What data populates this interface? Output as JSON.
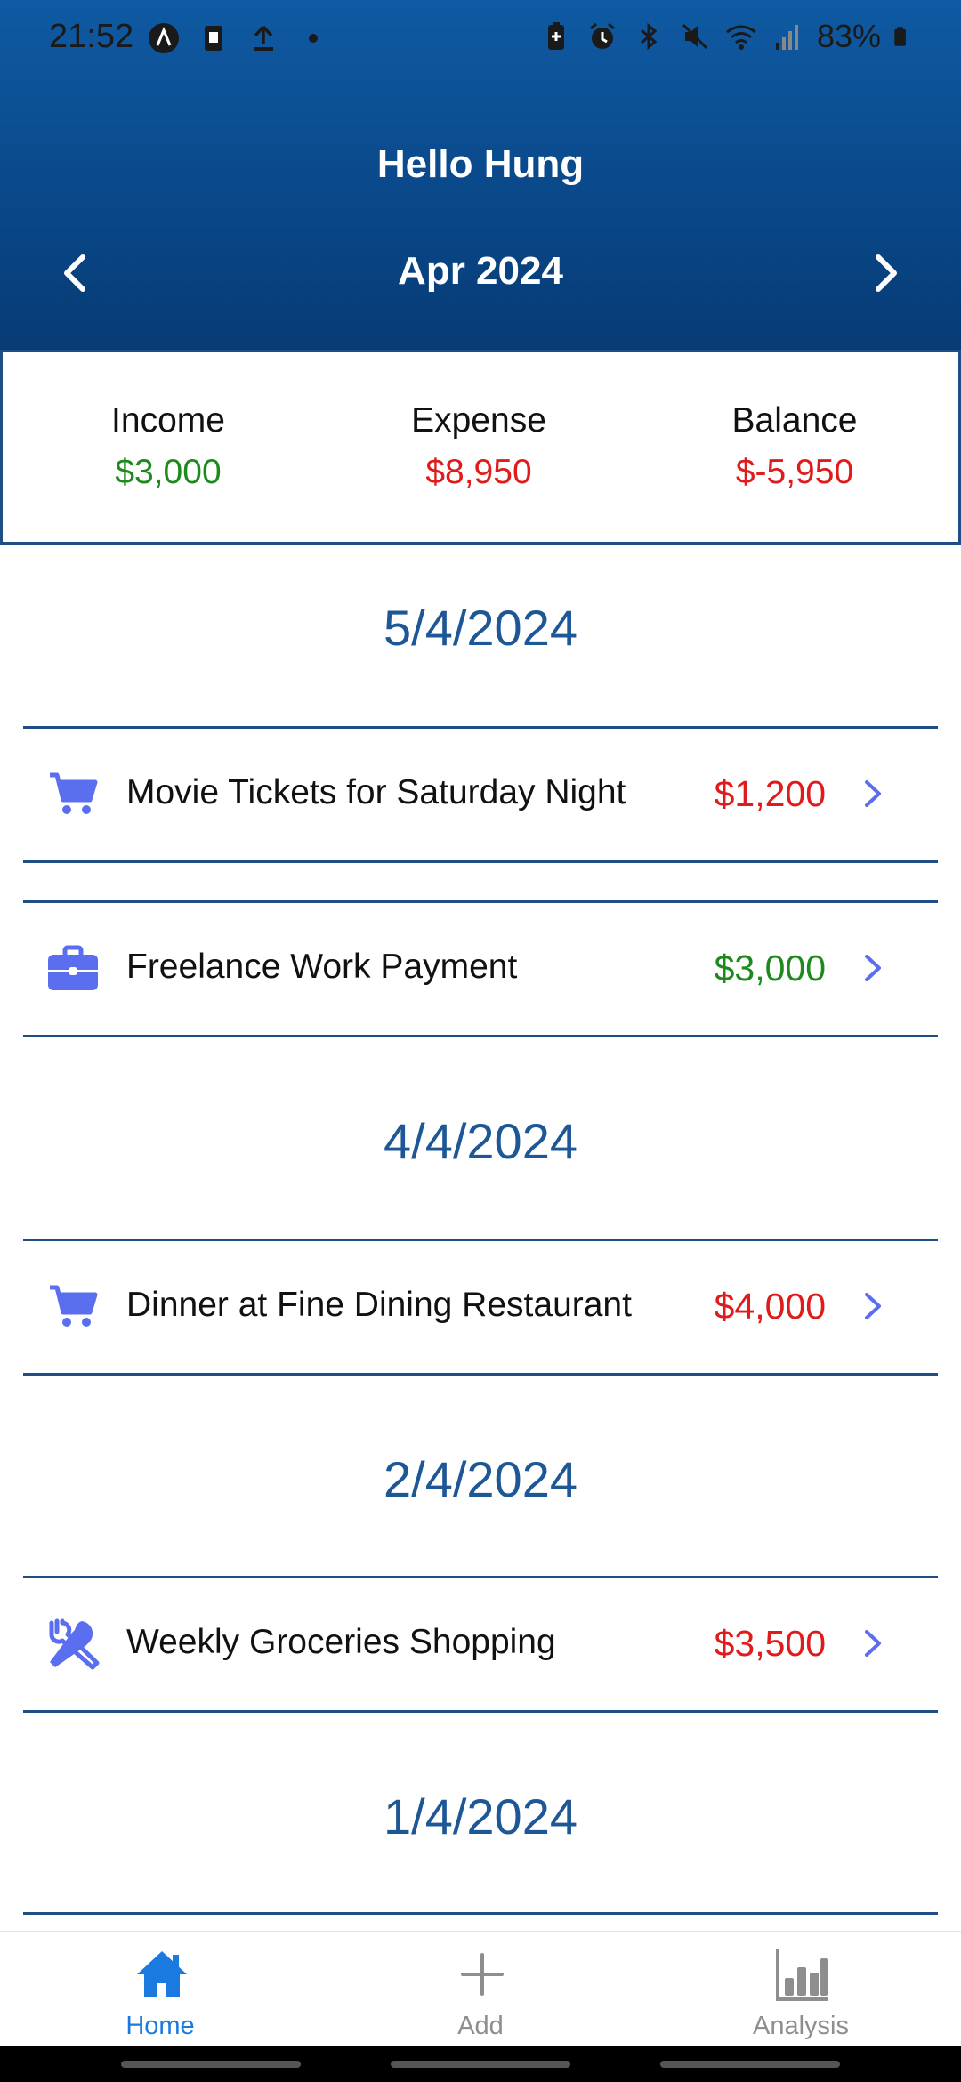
{
  "status_bar": {
    "time": "21:52",
    "battery": "83%",
    "icons": [
      "a-circle-icon",
      "sim-icon",
      "upload-icon",
      "dot-icon",
      "battery-saver-icon",
      "alarm-icon",
      "bluetooth-icon",
      "mute-icon",
      "wifi-icon",
      "signal-icon",
      "battery-icon"
    ]
  },
  "header": {
    "greeting": "Hello Hung",
    "month": "Apr 2024",
    "prev_icon": "chevron-left-icon",
    "next_icon": "chevron-right-icon"
  },
  "summary": {
    "income_label": "Income",
    "income_value": "$3,000",
    "expense_label": "Expense",
    "expense_value": "$8,950",
    "balance_label": "Balance",
    "balance_value": "$-5,950"
  },
  "groups": [
    {
      "date": "5/4/2024",
      "items": [
        {
          "title": "Movie Tickets for Saturday Night",
          "amount": "$1,200",
          "type": "expense",
          "icon": "cart-icon"
        },
        {
          "title": "Freelance Work Payment",
          "amount": "$3,000",
          "type": "income",
          "icon": "briefcase-icon"
        }
      ]
    },
    {
      "date": "4/4/2024",
      "items": [
        {
          "title": "Dinner at Fine Dining Restaurant",
          "amount": "$4,000",
          "type": "expense",
          "icon": "cart-icon"
        }
      ]
    },
    {
      "date": "2/4/2024",
      "items": [
        {
          "title": "Weekly Groceries Shopping",
          "amount": "$3,500",
          "type": "expense",
          "icon": "utensils-icon"
        }
      ]
    },
    {
      "date": "1/4/2024",
      "items": []
    }
  ],
  "bottom_nav": {
    "home_label": "Home",
    "add_label": "Add",
    "analysis_label": "Analysis",
    "active": "Home"
  },
  "colors": {
    "header_top": "#0f5aa3",
    "header_bottom": "#073b75",
    "accent": "#1d5796",
    "income": "#1e8a1e",
    "expense": "#e01b1b",
    "icon": "#5b6ef0",
    "tab_active": "#1a7ae0"
  }
}
